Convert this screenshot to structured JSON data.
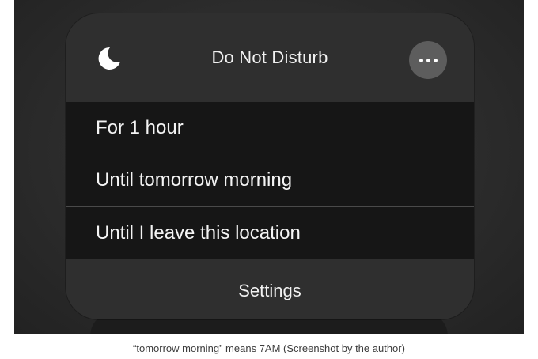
{
  "panel": {
    "title": "Do Not Disturb",
    "header_icon": "moon-icon",
    "more_icon": "ellipsis-icon",
    "options": [
      {
        "label": "For 1 hour"
      },
      {
        "label": "Until tomorrow morning"
      },
      {
        "label": "Until I leave this location"
      }
    ],
    "settings_label": "Settings"
  },
  "caption": "“tomorrow morning” means 7AM (Screenshot by the author)",
  "colors": {
    "panel_background": "#2f2f2f",
    "options_background": "#161616",
    "more_button_background": "#5d5d5d",
    "text": "#f4f4f4"
  }
}
